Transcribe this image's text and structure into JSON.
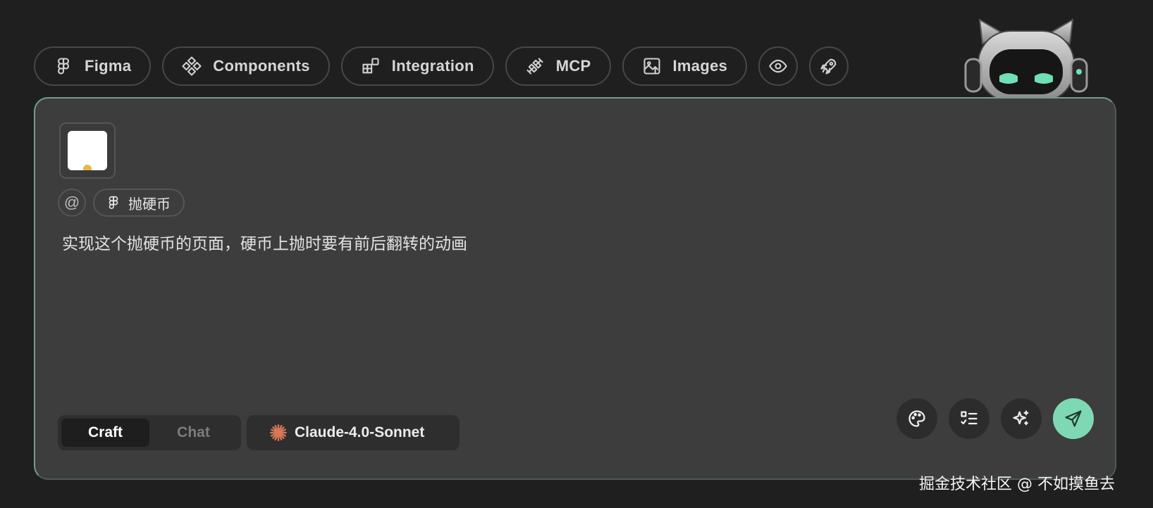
{
  "toolbar": {
    "items": [
      {
        "label": "Figma",
        "icon": "figma-icon"
      },
      {
        "label": "Components",
        "icon": "components-icon"
      },
      {
        "label": "Integration",
        "icon": "integration-icon"
      },
      {
        "label": "MCP",
        "icon": "plug-icon"
      },
      {
        "label": "Images",
        "icon": "image-upload-icon"
      }
    ],
    "round_buttons": [
      "eye-icon",
      "rocket-icon"
    ]
  },
  "mascot": "robot-cat-mascot",
  "composer": {
    "attachment": {
      "icon": "image-thumbnail"
    },
    "mention_symbol": "@",
    "mention_tag": {
      "label": "抛硬币",
      "icon": "figma-icon"
    },
    "prompt_value": "实现这个抛硬币的页面，硬币上抛时要有前后翻转的动画",
    "modes": {
      "craft": "Craft",
      "chat": "Chat",
      "selected": "Craft"
    },
    "model": {
      "label": "Claude-4.0-Sonnet",
      "icon": "claude-starburst-icon"
    },
    "actions": [
      "palette-icon",
      "checklist-icon",
      "sparkle-icon",
      "send-icon"
    ]
  },
  "watermark": "掘金技术社区 @ 不如摸鱼去",
  "colors": {
    "background": "#1f1f1f",
    "card": "#3d3d3d",
    "send_accent": "#7fd8b4",
    "claude_orange": "#d97757"
  }
}
